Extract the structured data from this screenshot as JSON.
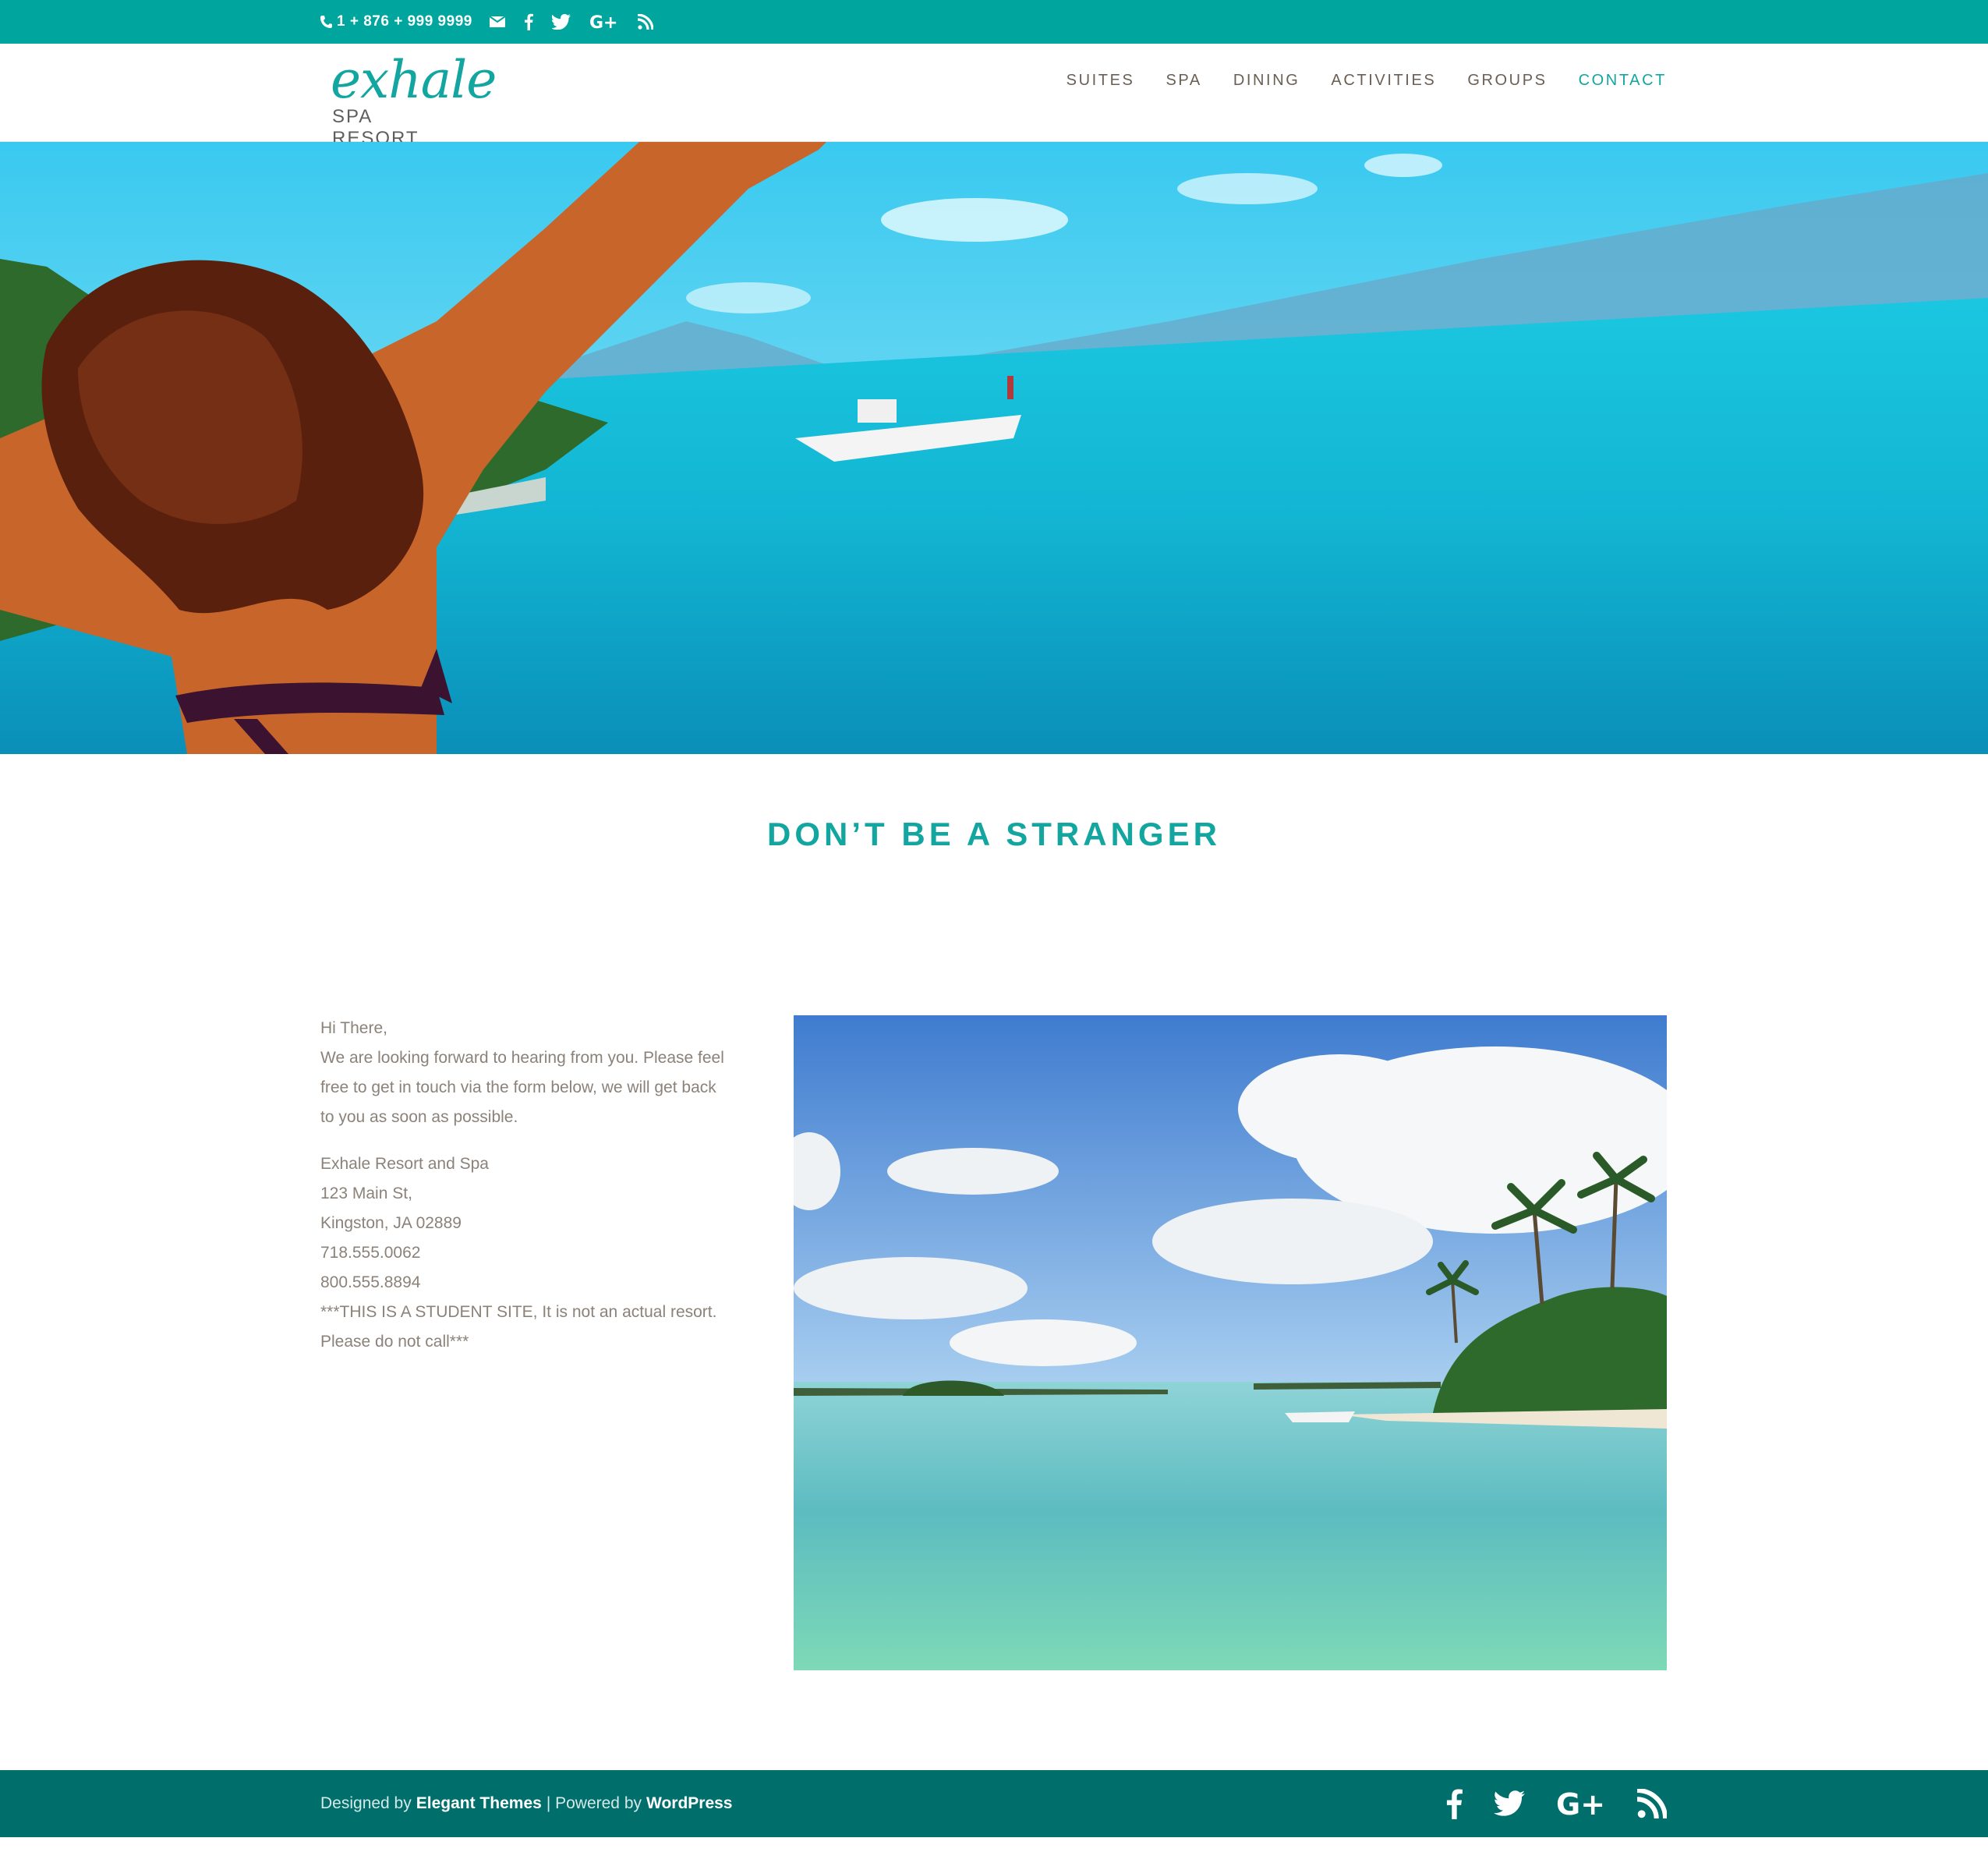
{
  "topbar": {
    "phone": "1 + 876 + 999 9999",
    "icons": [
      "phone-icon",
      "email-icon",
      "facebook-icon",
      "twitter-icon",
      "google-plus-icon",
      "rss-icon"
    ]
  },
  "logo": {
    "script": "exhale",
    "sub": "SPA RESORT"
  },
  "nav": {
    "items": [
      {
        "label": "SUITES"
      },
      {
        "label": "SPA"
      },
      {
        "label": "DINING"
      },
      {
        "label": "ACTIVITIES"
      },
      {
        "label": "GROUPS"
      },
      {
        "label": "CONTACT"
      }
    ],
    "active": "CONTACT"
  },
  "main": {
    "heading": "DON’T BE A STRANGER",
    "intro": {
      "greeting": "Hi There,",
      "body": "We are looking forward to hearing from you. Please feel free to get in touch via the form below, we will get back to you as soon as possible."
    },
    "address": {
      "name": "Exhale Resort and Spa",
      "street": "123 Main St,",
      "city": "Kingston, JA 02889",
      "phone1": "718.555.0062",
      "phone2": "800.555.8894",
      "note1": "***THIS IS A STUDENT SITE, It is not an actual resort.",
      "note2": "Please do not call***"
    }
  },
  "footer": {
    "designed_by": "Designed by",
    "designer": "Elegant Themes",
    "separator": "| Powered by",
    "platform": "WordPress",
    "icons": [
      "facebook-icon",
      "twitter-icon",
      "google-plus-icon",
      "rss-icon"
    ]
  },
  "colors": {
    "accent": "#00a59e",
    "footer": "#006e6a",
    "text": "#8b8279"
  }
}
